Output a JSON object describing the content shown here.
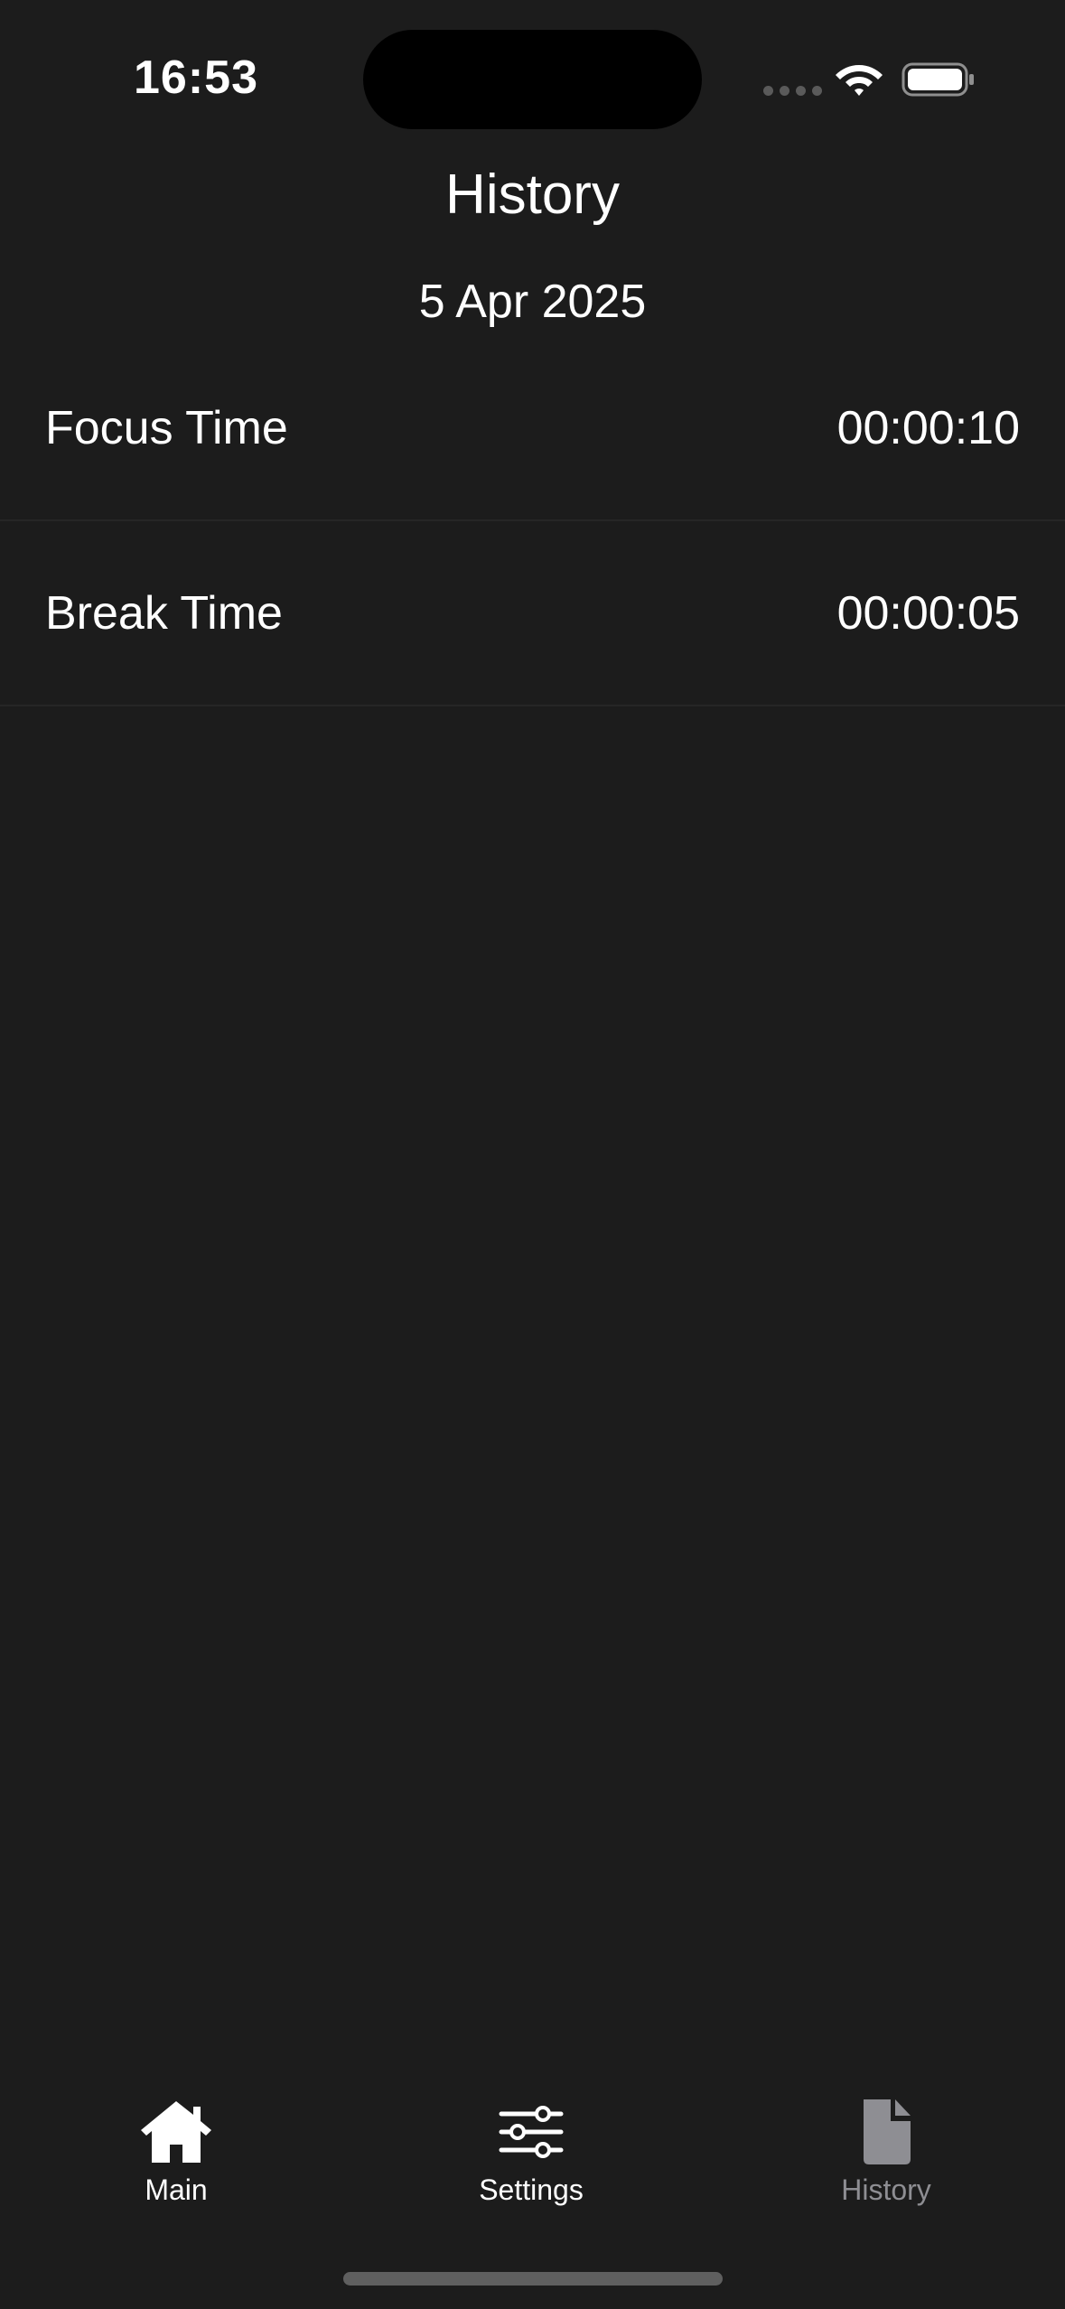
{
  "status_bar": {
    "time": "16:53"
  },
  "header": {
    "title": "History",
    "date": "5 Apr 2025"
  },
  "history": {
    "rows": [
      {
        "label": "Focus Time",
        "value": "00:00:10"
      },
      {
        "label": "Break Time",
        "value": "00:00:05"
      }
    ]
  },
  "tab_bar": {
    "tabs": [
      {
        "label": "Main",
        "icon": "house-icon",
        "selected": false
      },
      {
        "label": "Settings",
        "icon": "sliders-icon",
        "selected": false
      },
      {
        "label": "History",
        "icon": "document-icon",
        "selected": true
      }
    ]
  },
  "colors": {
    "background": "#1c1c1c",
    "text": "#ffffff",
    "active_tab": "#8e8e93",
    "separator": "#262626"
  }
}
